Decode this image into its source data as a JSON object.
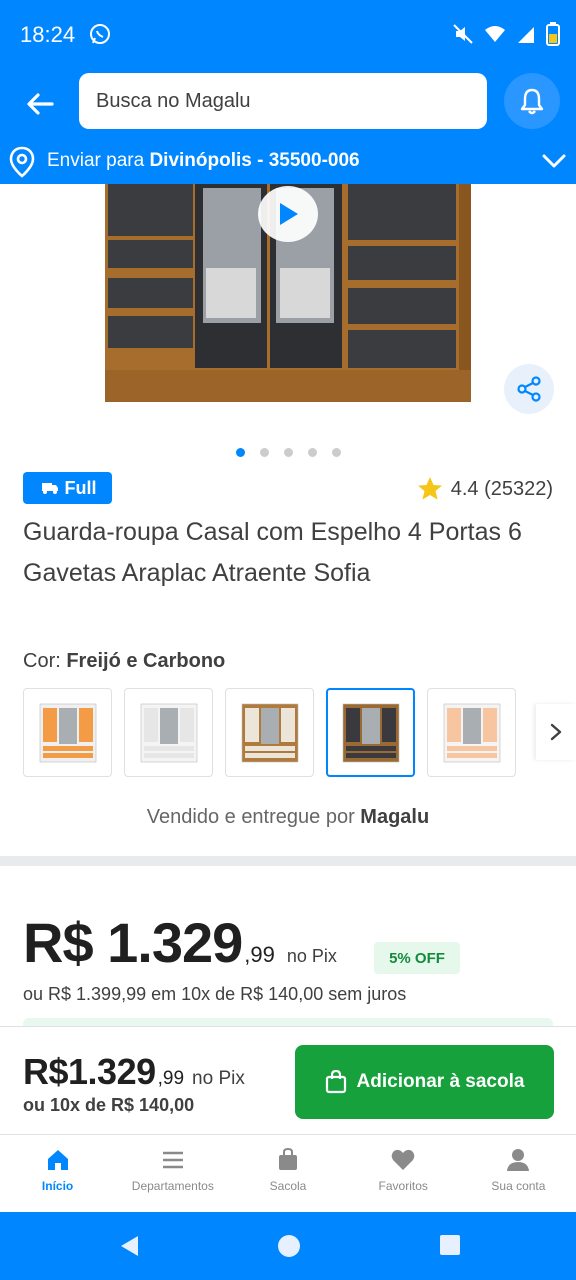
{
  "status_bar": {
    "time": "18:24"
  },
  "header": {
    "search_placeholder": "Busca no Magalu"
  },
  "location": {
    "prefix": "Enviar para ",
    "city": "Divinópolis - 35500-006"
  },
  "gallery": {
    "pages": 5,
    "active_page": 1
  },
  "product": {
    "badge": "Full",
    "rating": "4.4 (25322)",
    "title": "Guarda-roupa Casal com Espelho 4 Portas 6 Gavetas Araplac Atraente Sofia",
    "color_label": "Cor: ",
    "color_value": "Freijó e Carbono",
    "seller_prefix": "Vendido e entregue por ",
    "seller_name": "Magalu"
  },
  "color_options": [
    {
      "name": "orange-white",
      "frame": "#f0f0f0",
      "panel": "#f39c45"
    },
    {
      "name": "white",
      "frame": "#f4f4f4",
      "panel": "#e6e6e6"
    },
    {
      "name": "wood-off-white",
      "frame": "#b07a3c",
      "panel": "#ece6da"
    },
    {
      "name": "freijo-carbono",
      "frame": "#9b6a32",
      "panel": "#3a3a3e",
      "selected": true
    },
    {
      "name": "rose-white",
      "frame": "#f4f4f4",
      "panel": "#f7c5a0"
    }
  ],
  "price": {
    "main": "R$ 1.329",
    "cents": ",99",
    "pix": "no Pix",
    "off": "5% OFF",
    "installments": "ou R$ 1.399,99 em 10x de R$ 140,00 sem juros"
  },
  "buy_bar": {
    "price": "R$1.329",
    "cents": ",99",
    "pix": "no Pix",
    "installments": "ou 10x de R$ 140,00",
    "add_button": "Adicionar à sacola"
  },
  "bottom_nav": [
    {
      "label": "Início",
      "icon": "home-icon",
      "active": true
    },
    {
      "label": "Departamentos",
      "icon": "list-icon"
    },
    {
      "label": "Sacola",
      "icon": "bag-icon"
    },
    {
      "label": "Favoritos",
      "icon": "heart-icon"
    },
    {
      "label": "Sua conta",
      "icon": "user-icon"
    }
  ],
  "colors": {
    "brand": "#0086ff",
    "buy": "#17a13c",
    "star": "#f5c518"
  }
}
